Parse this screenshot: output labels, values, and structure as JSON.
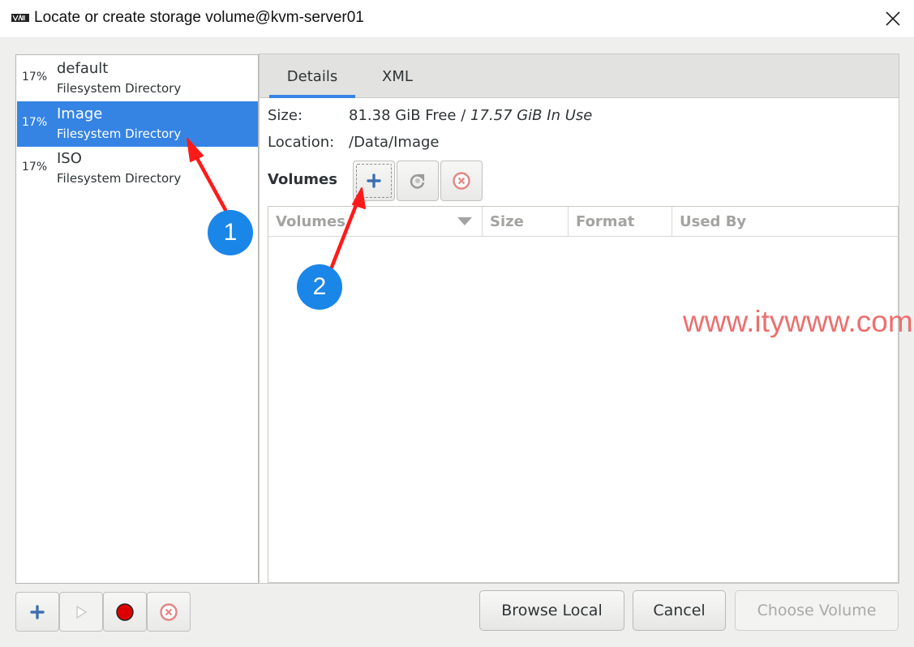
{
  "window": {
    "title": "Locate or create storage volume@kvm-server01",
    "close_icon": "close-icon"
  },
  "pools": [
    {
      "percent": "17%",
      "name": "default",
      "type": "Filesystem Directory",
      "selected": false
    },
    {
      "percent": "17%",
      "name": "Image",
      "type": "Filesystem Directory",
      "selected": true
    },
    {
      "percent": "17%",
      "name": "ISO",
      "type": "Filesystem Directory",
      "selected": false
    }
  ],
  "tabs": [
    {
      "label": "Details",
      "active": true
    },
    {
      "label": "XML",
      "active": false
    }
  ],
  "details": {
    "size_label": "Size:",
    "free": "81.38 GiB Free",
    "separator": " / ",
    "in_use": "17.57 GiB In Use",
    "location_label": "Location:",
    "location_value": "/Data/Image",
    "volumes_label": "Volumes"
  },
  "volume_table": {
    "columns": [
      "Volumes",
      "Size",
      "Format",
      "Used By"
    ],
    "rows": []
  },
  "pool_toolbar": {
    "icons": [
      "add-pool-icon",
      "start-pool-icon",
      "stop-pool-icon",
      "delete-pool-icon"
    ]
  },
  "buttons": {
    "browse_local": "Browse Local",
    "cancel": "Cancel",
    "choose_volume": "Choose Volume"
  },
  "annotations": {
    "badge1": "1",
    "badge2": "2",
    "watermark": "www.itywww.com"
  },
  "colors": {
    "selection": "#3584e4",
    "badge": "#1a86e8",
    "arrow": "#ff1a1a",
    "watermark": "#ec6f6f"
  }
}
